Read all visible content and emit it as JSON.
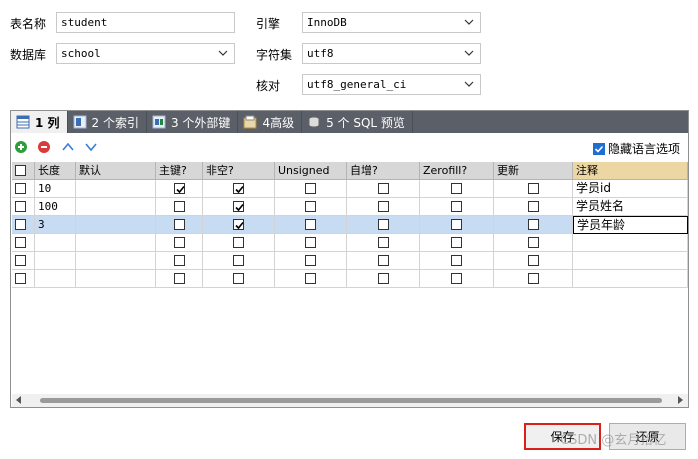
{
  "form": {
    "table_name_label": "表名称",
    "table_name_value": "student",
    "database_label": "数据库",
    "database_value": "school",
    "engine_label": "引擎",
    "engine_value": "InnoDB",
    "charset_label": "字符集",
    "charset_value": "utf8",
    "collation_label": "核对",
    "collation_value": "utf8_general_ci"
  },
  "tabs": [
    {
      "label": "1 列",
      "icon": "columns-icon",
      "active": true
    },
    {
      "label": "2 个索引",
      "icon": "index-icon",
      "active": false
    },
    {
      "label": "3 个外部键",
      "icon": "foreign-key-icon",
      "active": false
    },
    {
      "label": "4高级",
      "icon": "advanced-icon",
      "active": false
    },
    {
      "label": "5 个 SQL 预览",
      "icon": "sql-preview-icon",
      "active": false
    }
  ],
  "toolbar": {
    "hide_language_options_label": "隐藏语言选项",
    "hide_language_options_checked": true
  },
  "columns": {
    "headers": [
      "长度",
      "默认",
      "主键?",
      "非空?",
      "Unsigned",
      "自增?",
      "Zerofill?",
      "更新",
      "注释"
    ],
    "rows": [
      {
        "length": "10",
        "default": "",
        "pk": true,
        "notnull": true,
        "unsigned": false,
        "autoinc": false,
        "zerofill": false,
        "update": false,
        "comment": "学员id",
        "selected": false
      },
      {
        "length": "100",
        "default": "",
        "pk": false,
        "notnull": true,
        "unsigned": false,
        "autoinc": false,
        "zerofill": false,
        "update": false,
        "comment": "学员姓名",
        "selected": false
      },
      {
        "length": "3",
        "default": "",
        "pk": false,
        "notnull": true,
        "unsigned": false,
        "autoinc": false,
        "zerofill": false,
        "update": false,
        "comment": "学员年龄",
        "selected": true
      },
      {
        "length": "",
        "default": "",
        "pk": false,
        "notnull": false,
        "unsigned": false,
        "autoinc": false,
        "zerofill": false,
        "update": false,
        "comment": "",
        "selected": false
      },
      {
        "length": "",
        "default": "",
        "pk": false,
        "notnull": false,
        "unsigned": false,
        "autoinc": false,
        "zerofill": false,
        "update": false,
        "comment": "",
        "selected": false
      },
      {
        "length": "",
        "default": "",
        "pk": false,
        "notnull": false,
        "unsigned": false,
        "autoinc": false,
        "zerofill": false,
        "update": false,
        "comment": "",
        "selected": false
      }
    ]
  },
  "buttons": {
    "save_label": "保存",
    "restore_label": "还原"
  },
  "watermark_text": "CSDN @玄月拾忆",
  "colors": {
    "tab_bar": "#5b5f67",
    "selected_row": "#c7dcf3",
    "comment_header": "#ecd7a4",
    "save_highlight": "#d9201a"
  }
}
